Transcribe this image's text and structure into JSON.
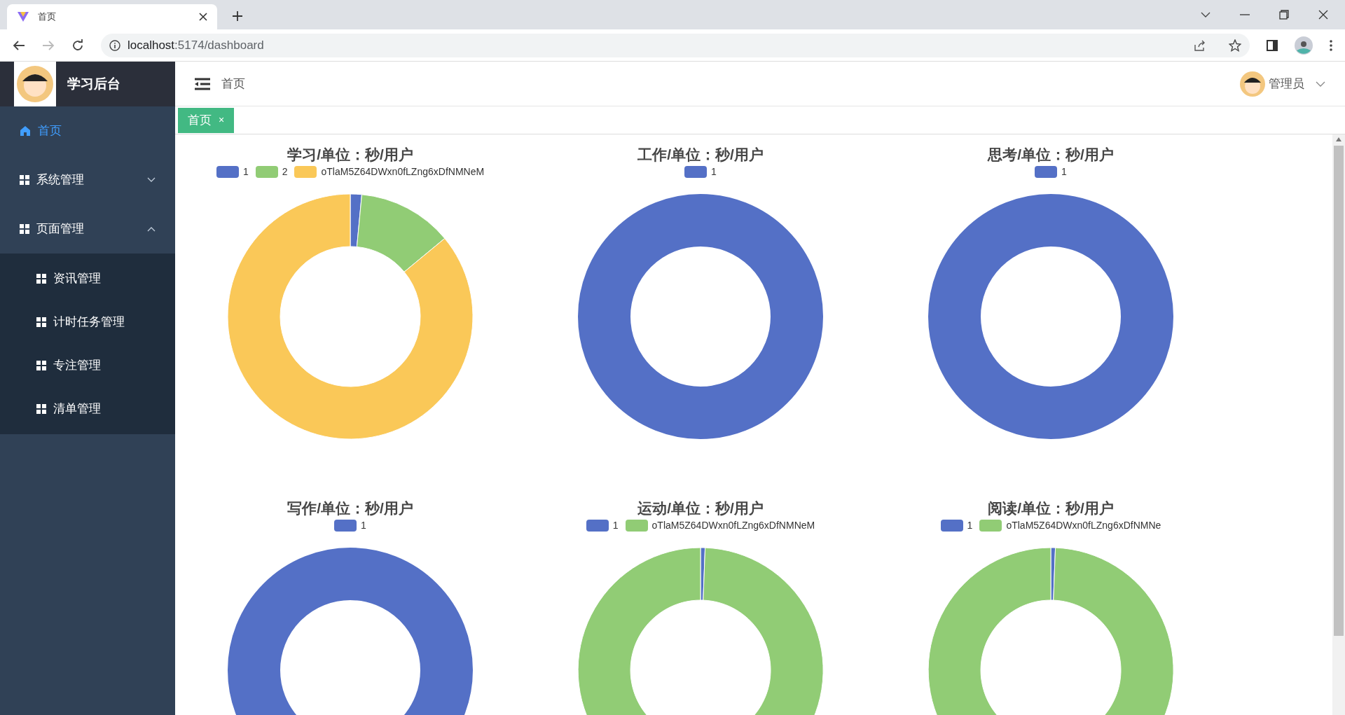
{
  "browser": {
    "tab_title": "首页",
    "url_host": "localhost",
    "url_path": ":5174/dashboard"
  },
  "sidebar": {
    "title": "学习后台",
    "items": [
      {
        "label": "首页",
        "selected": true
      },
      {
        "label": "系统管理",
        "selected": false,
        "expanded": false
      },
      {
        "label": "页面管理",
        "selected": false,
        "expanded": true,
        "children": [
          {
            "label": "资讯管理",
            "selected": false
          },
          {
            "label": "计时任务管理",
            "selected": false
          },
          {
            "label": "专注管理",
            "selected": false
          },
          {
            "label": "清单管理",
            "selected": false
          }
        ]
      }
    ]
  },
  "header": {
    "breadcrumb": "首页",
    "user": "管理员"
  },
  "tags": [
    {
      "label": "首页",
      "selected": true,
      "close": "×"
    }
  ],
  "charts": [
    {
      "title": "学习/单位：秒/用户",
      "legend": [
        {
          "label": "1",
          "color": "#5470c6"
        },
        {
          "label": "2",
          "color": "#91cc75"
        },
        {
          "label": "oTlaM5Z64DWxn0fLZng6xDfNMNeM",
          "color": "#fac858"
        }
      ]
    },
    {
      "title": "工作/单位：秒/用户",
      "legend": [
        {
          "label": "1",
          "color": "#5470c6"
        }
      ]
    },
    {
      "title": "思考/单位：秒/用户",
      "legend": [
        {
          "label": "1",
          "color": "#5470c6"
        }
      ]
    },
    {
      "title": "写作/单位：秒/用户",
      "legend": [
        {
          "label": "1",
          "color": "#5470c6"
        }
      ]
    },
    {
      "title": "运动/单位：秒/用户",
      "legend": [
        {
          "label": "1",
          "color": "#5470c6"
        },
        {
          "label": "oTlaM5Z64DWxn0fLZng6xDfNMNeM",
          "color": "#91cc75"
        }
      ]
    },
    {
      "title": "阅读/单位：秒/用户",
      "legend": [
        {
          "label": "1",
          "color": "#5470c6"
        },
        {
          "label": "oTlaM5Z64DWxn0fLZng6xDfNMNe",
          "color": "#91cc75"
        }
      ]
    }
  ]
}
